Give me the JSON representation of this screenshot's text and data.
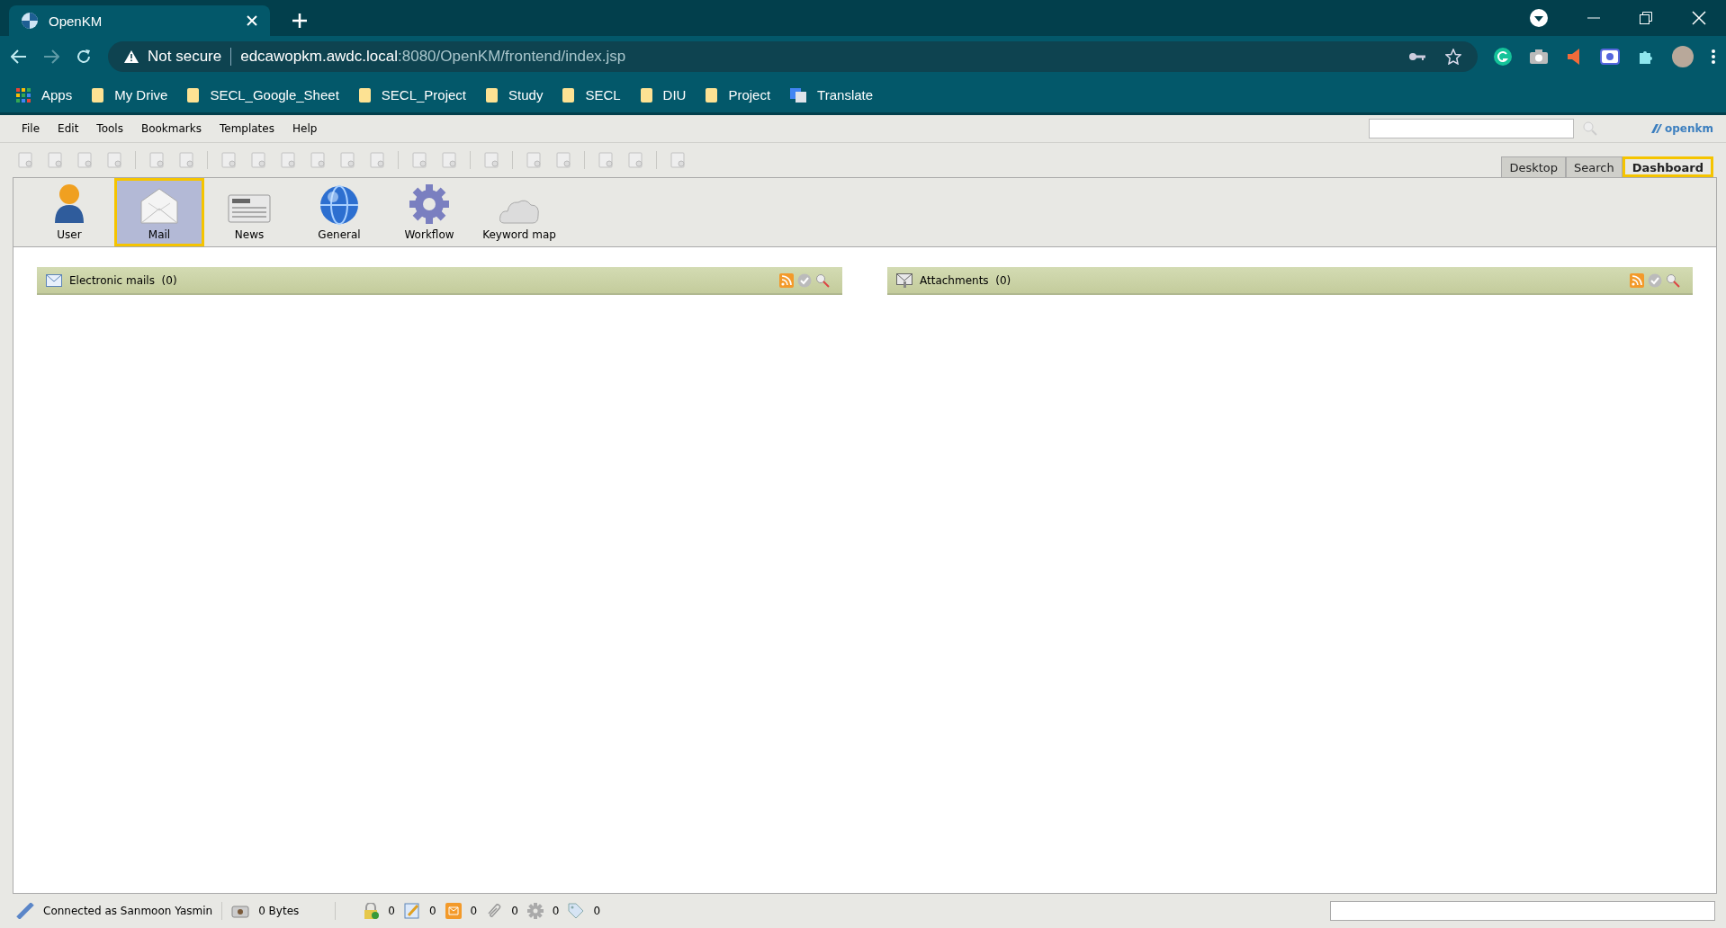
{
  "browser": {
    "tab_title": "OpenKM",
    "security": "Not secure",
    "url_host": "edcawopkm.awdc.local",
    "url_rest": ":8080/OpenKM/frontend/index.jsp",
    "bookmarks": [
      {
        "kind": "apps",
        "label": "Apps"
      },
      {
        "kind": "folder",
        "label": "My Drive"
      },
      {
        "kind": "folder",
        "label": "SECL_Google_Sheet"
      },
      {
        "kind": "folder",
        "label": "SECL_Project"
      },
      {
        "kind": "folder",
        "label": "Study"
      },
      {
        "kind": "folder",
        "label": "SECL"
      },
      {
        "kind": "folder",
        "label": "DIU"
      },
      {
        "kind": "folder",
        "label": "Project"
      },
      {
        "kind": "translate",
        "label": "Translate"
      }
    ]
  },
  "menu": [
    "File",
    "Edit",
    "Tools",
    "Bookmarks",
    "Templates",
    "Help"
  ],
  "logo": "openkm",
  "tabs": [
    {
      "label": "Desktop",
      "selected": false
    },
    {
      "label": "Search",
      "selected": false
    },
    {
      "label": "Dashboard",
      "selected": true
    }
  ],
  "dashboard_tools": [
    {
      "kind": "user",
      "label": "User",
      "selected": false
    },
    {
      "kind": "mail",
      "label": "Mail",
      "selected": true
    },
    {
      "kind": "news",
      "label": "News",
      "selected": false
    },
    {
      "kind": "general",
      "label": "General",
      "selected": false
    },
    {
      "kind": "workflow",
      "label": "Workflow",
      "selected": false
    },
    {
      "kind": "keyword",
      "label": "Keyword map",
      "selected": false
    }
  ],
  "panels": [
    {
      "kind": "mail",
      "title": "Electronic mails",
      "count": "(0)"
    },
    {
      "kind": "attachment",
      "title": "Attachments",
      "count": "(0)"
    }
  ],
  "status_bar": {
    "user": "Connected as Sanmoon Yasmin",
    "size": "0 Bytes",
    "counters": [
      {
        "kind": "locked",
        "value": "0"
      },
      {
        "kind": "edit",
        "value": "0"
      },
      {
        "kind": "mail",
        "value": "0"
      },
      {
        "kind": "attachment",
        "value": "0"
      },
      {
        "kind": "workflow",
        "value": "0"
      },
      {
        "kind": "tag",
        "value": "0"
      }
    ]
  }
}
